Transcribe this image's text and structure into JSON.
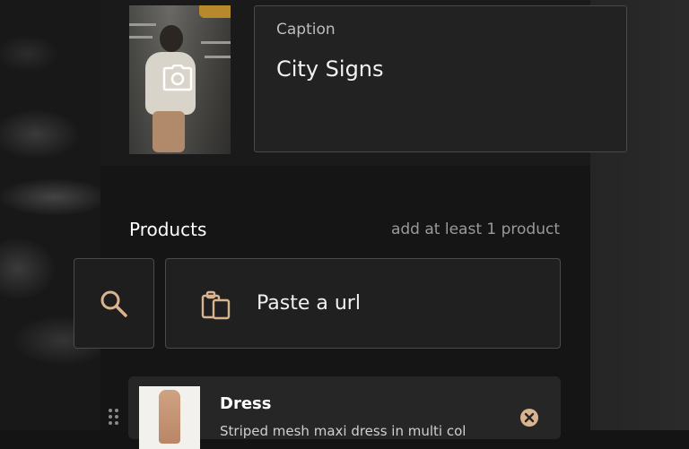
{
  "post": {
    "photo_icon": "camera-icon",
    "caption": {
      "label": "Caption",
      "value": "City Signs"
    }
  },
  "products": {
    "title": "Products",
    "hint": "add at least 1 product",
    "search_icon": "search-icon",
    "paste": {
      "icon": "clipboard-icon",
      "label": "Paste a url"
    },
    "items": [
      {
        "name": "Dress",
        "description": "Striped mesh maxi dress in multi col",
        "remove_icon": "close-circle-icon"
      }
    ]
  },
  "colors": {
    "accent": "#d9b48f",
    "background": "#151515",
    "card": "#262626",
    "border": "#4a4a4a"
  }
}
